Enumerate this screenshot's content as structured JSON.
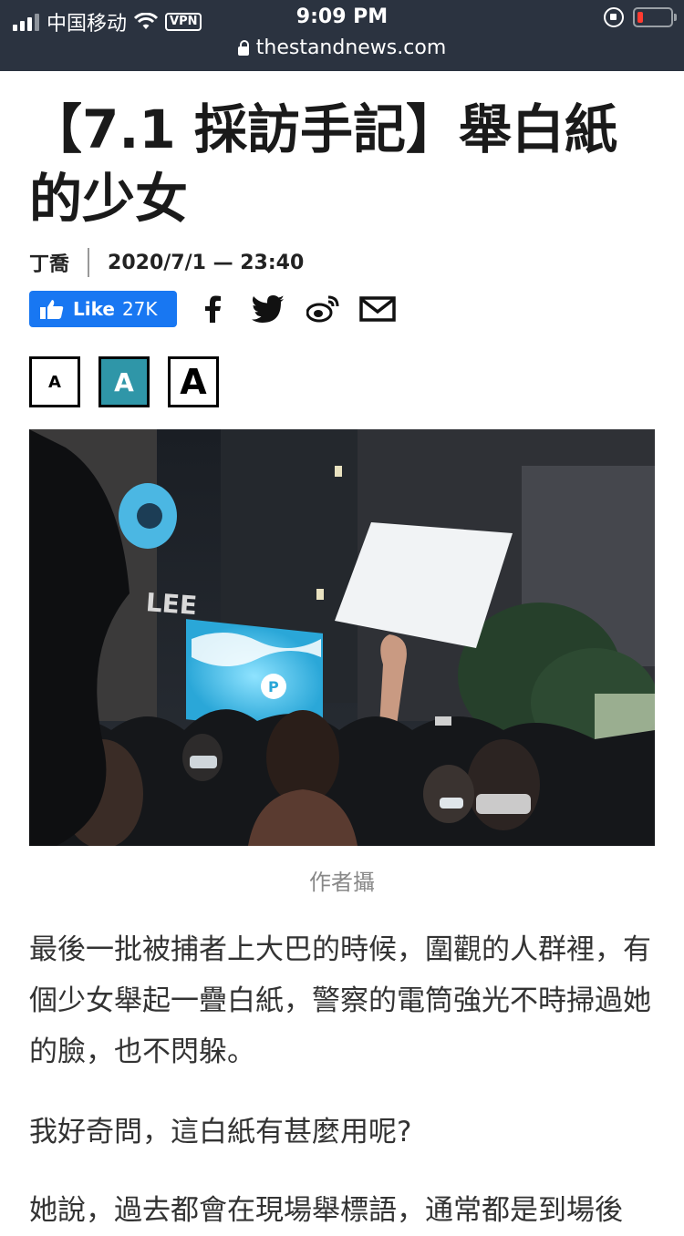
{
  "status_bar": {
    "carrier": "中国移动",
    "vpn": "VPN",
    "time": "9:09 PM",
    "url": "thestandnews.com"
  },
  "article": {
    "title": "【7.1 採訪手記】舉白紙的少女",
    "author": "丁喬",
    "datetime": "2020/7/1 — 23:40",
    "like": {
      "label": "Like",
      "count": "27K"
    },
    "share_icons": [
      "facebook-icon",
      "twitter-icon",
      "weibo-icon",
      "mail-icon"
    ],
    "font_sizes": [
      {
        "label": "A",
        "size": "small"
      },
      {
        "label": "A",
        "size": "medium",
        "selected": true
      },
      {
        "label": "A",
        "size": "large"
      }
    ],
    "photo_caption": "作者攝",
    "paragraphs": [
      "最後一批被捕者上大巴的時候，圍觀的人群裡，有個少女舉起一疊白紙，警察的電筒強光不時掃過她的臉，也不閃躲。",
      "我好奇問，這白紙有甚麼用呢?",
      "她說，過去都會在現場舉標語，通常都是到場後"
    ]
  },
  "colors": {
    "status_bg": "#2b3340",
    "facebook_blue": "#1877f2",
    "accent_teal": "#2f96a8"
  }
}
